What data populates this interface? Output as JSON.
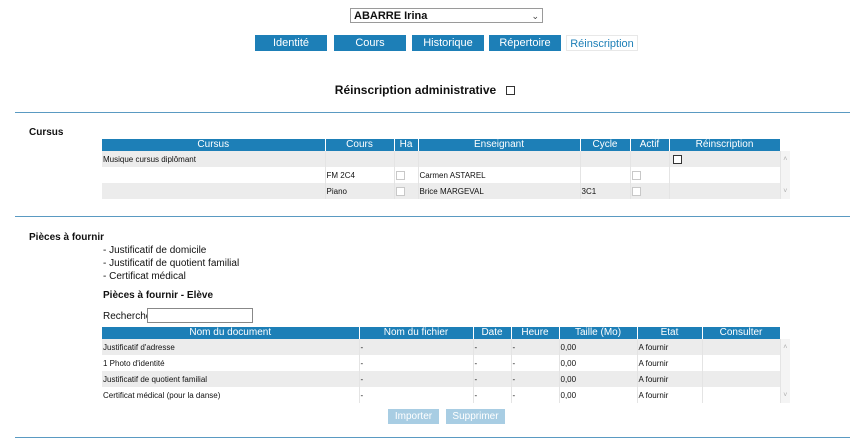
{
  "student": {
    "selected": "ABARRE Irina"
  },
  "tabs": [
    {
      "label": "Identité"
    },
    {
      "label": "Cours"
    },
    {
      "label": "Historique"
    },
    {
      "label": "Répertoire"
    },
    {
      "label": "Réinscription"
    }
  ],
  "admin": {
    "title": "Réinscription administrative"
  },
  "cursus": {
    "section_label": "Cursus",
    "headers": [
      "Cursus",
      "Cours",
      "Ha",
      "Enseignant",
      "Cycle",
      "Actif",
      "Réinscription"
    ],
    "rows": [
      {
        "cursus": "Musique cursus diplômant",
        "cours": "",
        "enseignant": "",
        "cycle": ""
      },
      {
        "cursus": "",
        "cours": "FM 2C4",
        "enseignant": "Carmen ASTAREL",
        "cycle": ""
      },
      {
        "cursus": "",
        "cours": "Piano",
        "enseignant": "Brice MARGEVAL",
        "cycle": "3C1"
      }
    ]
  },
  "pieces": {
    "section_label": "Pièces à fournir",
    "list": [
      "- Justificatif de domicile",
      "- Justificatif de quotient familial",
      "- Certificat médical"
    ],
    "eleve_label": "Pièces à fournir - Elève",
    "search_label": "Recherche",
    "search_value": "",
    "headers": [
      "Nom du document",
      "Nom du fichier",
      "Date",
      "Heure",
      "Taille (Mo)",
      "Etat",
      "Consulter"
    ],
    "rows": [
      {
        "document": "Justificatif d'adresse",
        "fichier": "-",
        "date": "-",
        "heure": "-",
        "taille": "0,00",
        "etat": "A fournir",
        "consulter": ""
      },
      {
        "document": "1 Photo d'identité",
        "fichier": "-",
        "date": "-",
        "heure": "-",
        "taille": "0,00",
        "etat": "A fournir",
        "consulter": ""
      },
      {
        "document": "Justificatif de quotient familial",
        "fichier": "-",
        "date": "-",
        "heure": "-",
        "taille": "0,00",
        "etat": "A fournir",
        "consulter": ""
      },
      {
        "document": "Certificat médical (pour la danse)",
        "fichier": "-",
        "date": "-",
        "heure": "-",
        "taille": "0,00",
        "etat": "A fournir",
        "consulter": ""
      }
    ]
  },
  "buttons": {
    "import_label": "Importer",
    "delete_label": "Supprimer"
  },
  "colors": {
    "accent": "#1d7fb7",
    "divider": "#5a9ac2",
    "disabled_button": "#a8cde3",
    "row_alt": "#ececec"
  },
  "icons": {
    "select_chevron": "chevron-down-icon",
    "scroll_up": "scroll-up-icon",
    "scroll_down": "scroll-down-icon"
  }
}
